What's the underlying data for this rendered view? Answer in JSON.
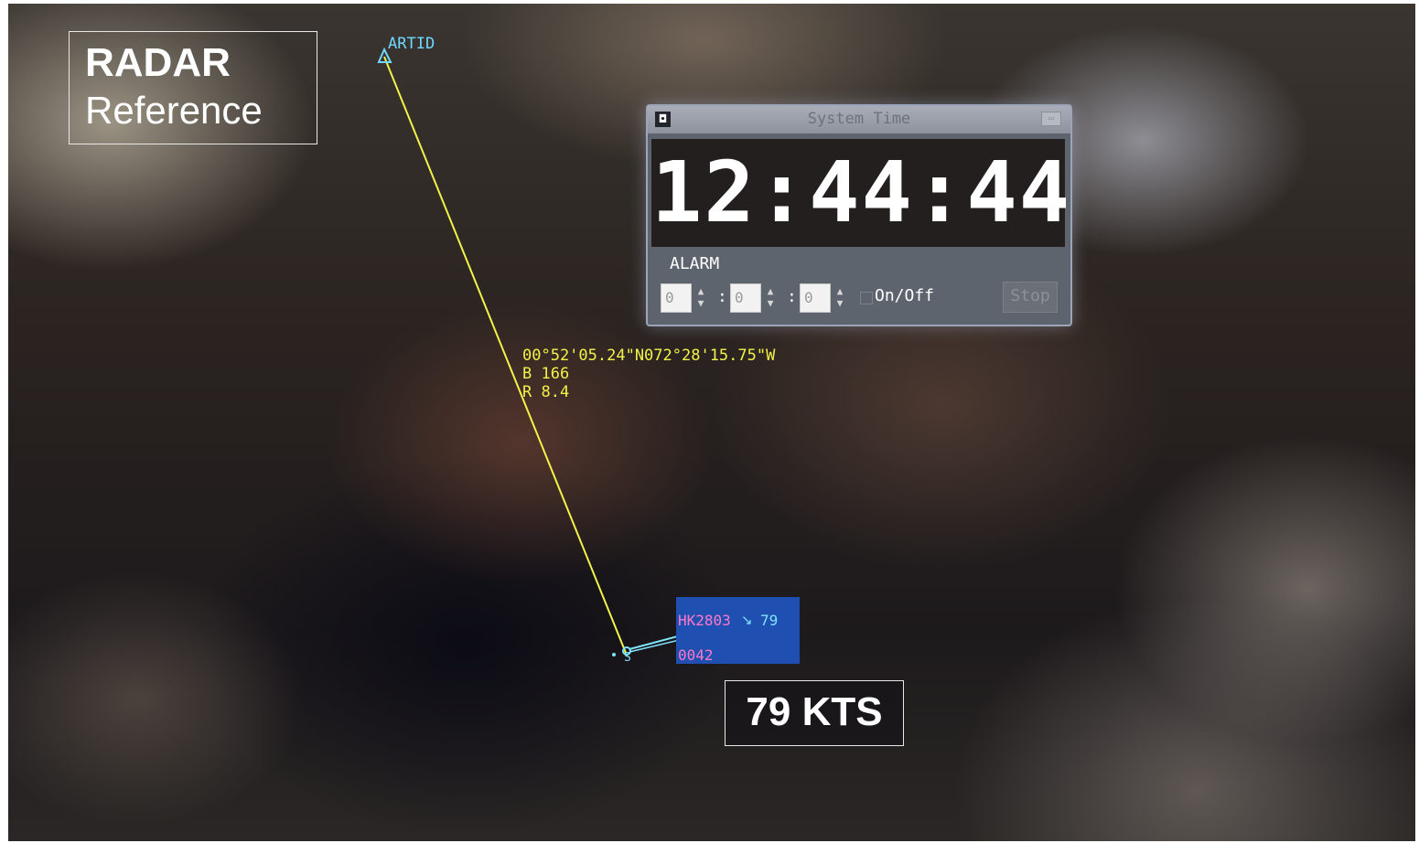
{
  "reference_box": {
    "title": "RADAR",
    "subtitle": "Reference"
  },
  "reference_point": {
    "label": "ARTID"
  },
  "cursor_readout": {
    "position": "00°52'05.24\"N072°28'15.75\"W",
    "bearing": "B 166",
    "range": "R 8.4"
  },
  "system_time_window": {
    "title": "System Time",
    "time": "12:44:44",
    "alarm_label": "ALARM",
    "alarm_hours": "0",
    "alarm_minutes": "0",
    "alarm_seconds": "0",
    "separator": ":",
    "onoff_label": "On/Off",
    "onoff_checked": false,
    "stop_label": "Stop"
  },
  "track": {
    "callsign": "HK2803",
    "heading_arrow": "↘",
    "ground_speed": "79",
    "squawk": "0042",
    "symbol_label": "S"
  },
  "speed_callout": {
    "text": "79 KTS"
  },
  "colors": {
    "reference_cyan": "#6fd8ff",
    "range_bearing_line": "#f2f24a",
    "datablock_bg": "#1f4fb0",
    "callsign_pink": "#ff77c8"
  }
}
